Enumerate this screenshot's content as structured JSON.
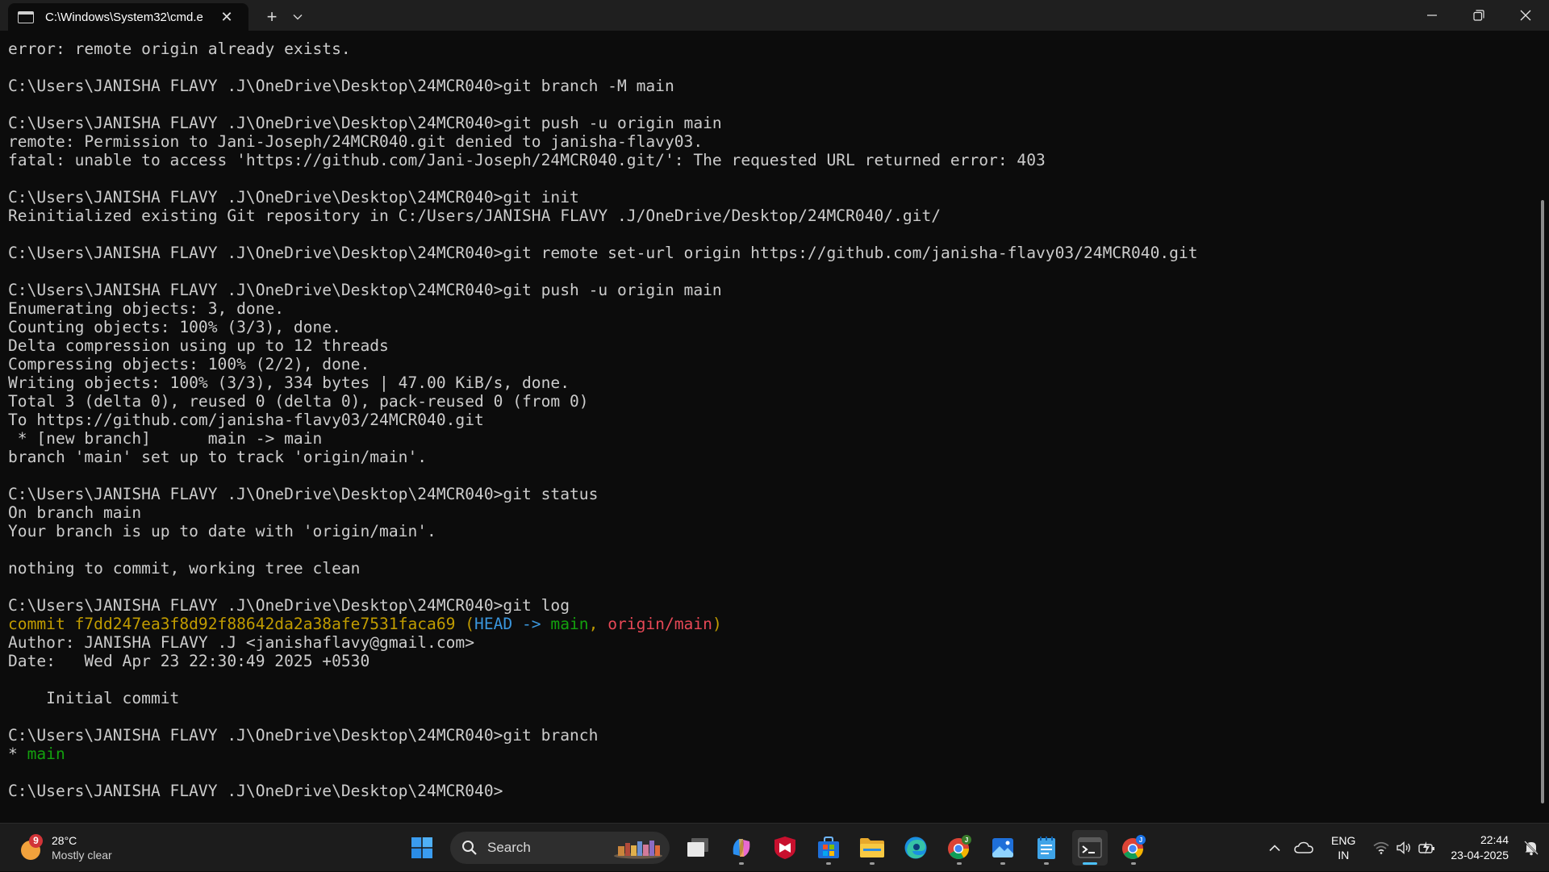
{
  "titlebar": {
    "tab_title": "C:\\Windows\\System32\\cmd.e",
    "close_glyph": "✕",
    "new_tab_glyph": "+",
    "dropdown_glyph": "⌄"
  },
  "terminal": {
    "lines": [
      [
        {
          "t": "error: remote origin already exists."
        }
      ],
      [],
      [
        {
          "t": "C:\\Users\\JANISHA FLAVY .J\\OneDrive\\Desktop\\24MCR040>git branch -M main"
        }
      ],
      [],
      [
        {
          "t": "C:\\Users\\JANISHA FLAVY .J\\OneDrive\\Desktop\\24MCR040>git push -u origin main"
        }
      ],
      [
        {
          "t": "remote: Permission to Jani-Joseph/24MCR040.git denied to janisha-flavy03."
        }
      ],
      [
        {
          "t": "fatal: unable to access 'https://github.com/Jani-Joseph/24MCR040.git/': The requested URL returned error: 403"
        }
      ],
      [],
      [
        {
          "t": "C:\\Users\\JANISHA FLAVY .J\\OneDrive\\Desktop\\24MCR040>git init"
        }
      ],
      [
        {
          "t": "Reinitialized existing Git repository in C:/Users/JANISHA FLAVY .J/OneDrive/Desktop/24MCR040/.git/"
        }
      ],
      [],
      [
        {
          "t": "C:\\Users\\JANISHA FLAVY .J\\OneDrive\\Desktop\\24MCR040>git remote set-url origin https://github.com/janisha-flavy03/24MCR040.git"
        }
      ],
      [],
      [
        {
          "t": "C:\\Users\\JANISHA FLAVY .J\\OneDrive\\Desktop\\24MCR040>git push -u origin main"
        }
      ],
      [
        {
          "t": "Enumerating objects: 3, done."
        }
      ],
      [
        {
          "t": "Counting objects: 100% (3/3), done."
        }
      ],
      [
        {
          "t": "Delta compression using up to 12 threads"
        }
      ],
      [
        {
          "t": "Compressing objects: 100% (2/2), done."
        }
      ],
      [
        {
          "t": "Writing objects: 100% (3/3), 334 bytes | 47.00 KiB/s, done."
        }
      ],
      [
        {
          "t": "Total 3 (delta 0), reused 0 (delta 0), pack-reused 0 (from 0)"
        }
      ],
      [
        {
          "t": "To https://github.com/janisha-flavy03/24MCR040.git"
        }
      ],
      [
        {
          "t": " * [new branch]      main -> main"
        }
      ],
      [
        {
          "t": "branch 'main' set up to track 'origin/main'."
        }
      ],
      [],
      [
        {
          "t": "C:\\Users\\JANISHA FLAVY .J\\OneDrive\\Desktop\\24MCR040>git status"
        }
      ],
      [
        {
          "t": "On branch main"
        }
      ],
      [
        {
          "t": "Your branch is up to date with 'origin/main'."
        }
      ],
      [],
      [
        {
          "t": "nothing to commit, working tree clean"
        }
      ],
      [],
      [
        {
          "t": "C:\\Users\\JANISHA FLAVY .J\\OneDrive\\Desktop\\24MCR040>git log"
        }
      ],
      [
        {
          "t": "commit f7dd247ea3f8d92f88642da2a38afe7531faca69 (",
          "c": "yellow"
        },
        {
          "t": "HEAD -> ",
          "c": "cyan"
        },
        {
          "t": "main",
          "c": "green"
        },
        {
          "t": ", ",
          "c": "yellow"
        },
        {
          "t": "origin/main",
          "c": "red"
        },
        {
          "t": ")",
          "c": "yellow"
        }
      ],
      [
        {
          "t": "Author: JANISHA FLAVY .J <janishaflavy@gmail.com>"
        }
      ],
      [
        {
          "t": "Date:   Wed Apr 23 22:30:49 2025 +0530"
        }
      ],
      [],
      [
        {
          "t": "    Initial commit"
        }
      ],
      [],
      [
        {
          "t": "C:\\Users\\JANISHA FLAVY .J\\OneDrive\\Desktop\\24MCR040>git branch"
        }
      ],
      [
        {
          "t": "* "
        },
        {
          "t": "main",
          "c": "green"
        }
      ],
      [],
      [
        {
          "t": "C:\\Users\\JANISHA FLAVY .J\\OneDrive\\Desktop\\24MCR040>"
        }
      ]
    ],
    "colors": {
      "background": "#0c0c0c",
      "foreground": "#cccccc",
      "yellow": "#c19c00",
      "cyan": "#3a96dd",
      "green": "#13a10e",
      "red": "#e74856"
    }
  },
  "taskbar": {
    "weather": {
      "badge": "9",
      "temperature": "28°C",
      "condition": "Mostly clear"
    },
    "search": {
      "label": "Search"
    },
    "center_icons": [
      {
        "name": "start-button-windows-icon",
        "running": false
      },
      {
        "name": "search-box",
        "running": false
      },
      {
        "name": "task-view-icon",
        "running": false
      },
      {
        "name": "copilot-icon",
        "running": true
      },
      {
        "name": "mcafee-icon",
        "running": false
      },
      {
        "name": "microsoft-store-icon",
        "running": true
      },
      {
        "name": "file-explorer-icon",
        "running": true
      },
      {
        "name": "edge-icon",
        "running": false
      },
      {
        "name": "chrome-profile-j-icon",
        "running": true
      },
      {
        "name": "photos-icon",
        "running": true
      },
      {
        "name": "notepad-icon",
        "running": true
      },
      {
        "name": "terminal-icon",
        "running": true,
        "active": true
      },
      {
        "name": "chrome-profile-j-blue-icon",
        "running": true
      }
    ],
    "tray": {
      "language_line1": "ENG",
      "language_line2": "IN",
      "time": "22:44",
      "date": "23-04-2025"
    }
  }
}
